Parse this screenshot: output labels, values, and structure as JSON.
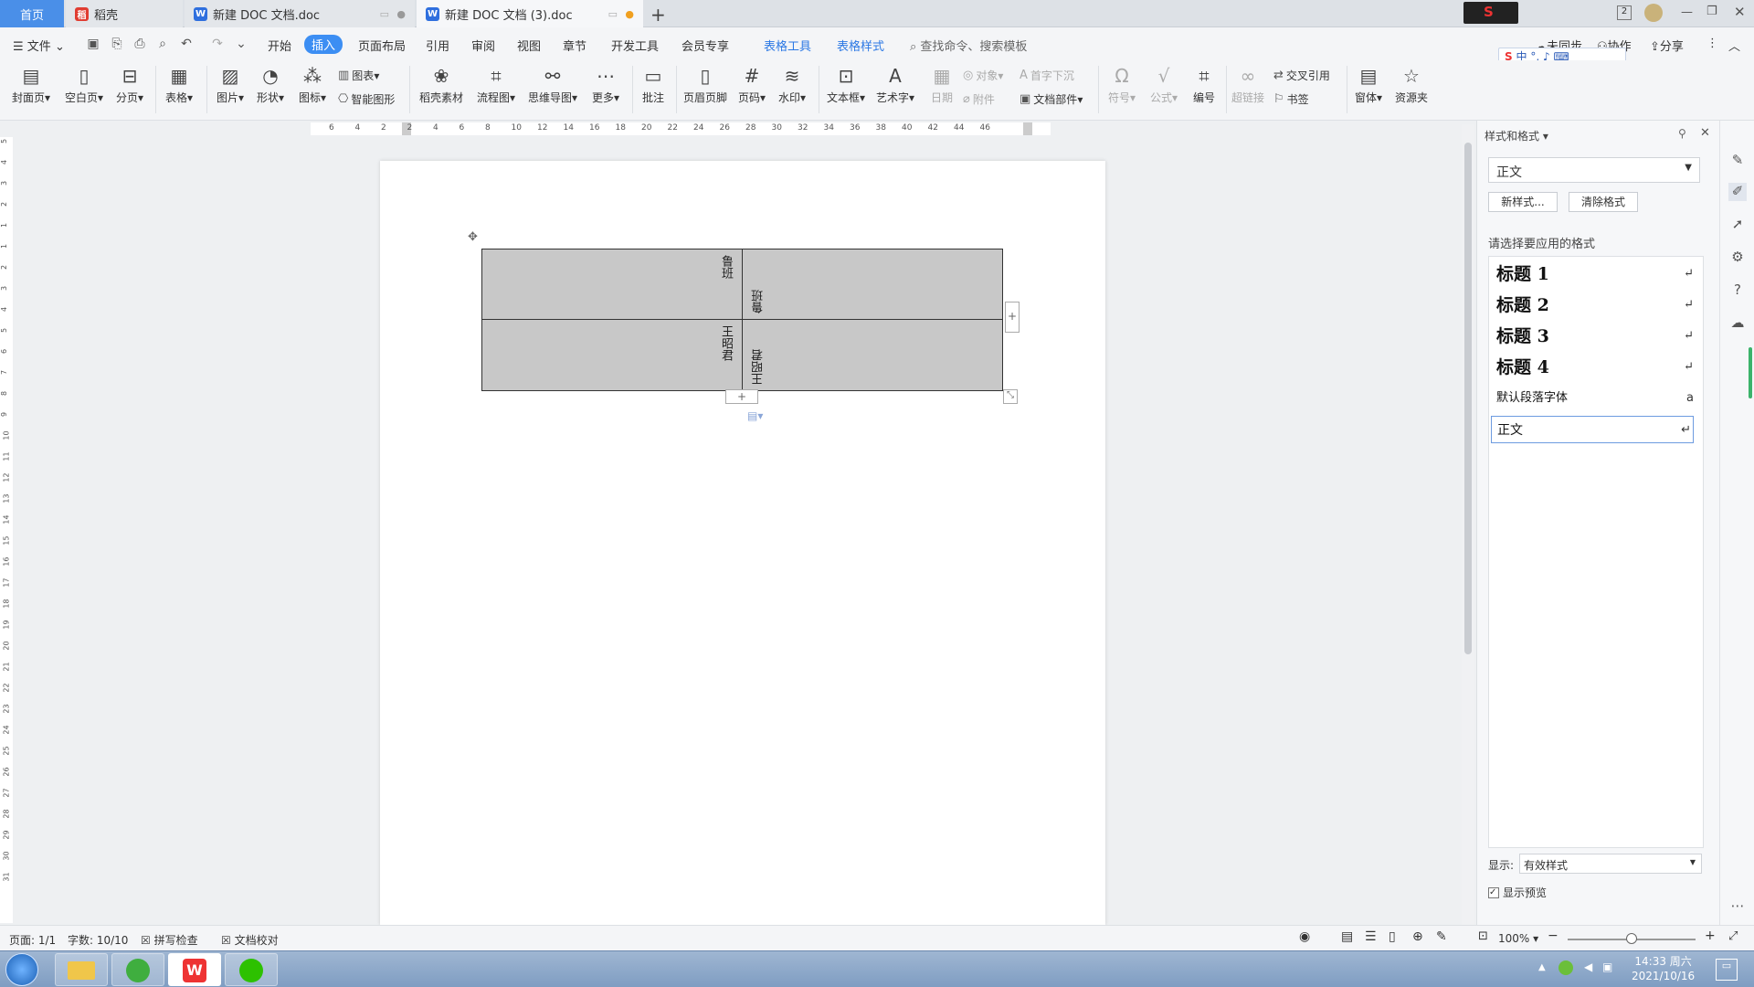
{
  "tabs": {
    "home": "首页",
    "daoke": "稻壳",
    "doc1": "新建 DOC 文档.doc",
    "doc2": "新建 DOC 文档 (3).doc"
  },
  "menubar": {
    "file": "文件",
    "items": [
      "开始",
      "插入",
      "页面布局",
      "引用",
      "审阅",
      "视图",
      "章节",
      "开发工具",
      "会员专享"
    ],
    "context_tabs": [
      "表格工具",
      "表格样式"
    ],
    "search": "查找命令、搜索模板",
    "sync": "未同步",
    "collab": "协作",
    "share": "分享"
  },
  "ribbon": {
    "cover": "封面页",
    "blank": "空白页",
    "pagebreak": "分页",
    "table": "表格",
    "picture": "图片",
    "shape": "形状",
    "icon": "图标",
    "chart": "图表",
    "smartart": "智能图形",
    "daoke_material": "稻壳素材",
    "flowchart": "流程图",
    "mindmap": "思维导图",
    "more": "更多",
    "comment": "批注",
    "header_footer": "页眉页脚",
    "page_number": "页码",
    "watermark": "水印",
    "textbox": "文本框",
    "wordart": "艺术字",
    "date": "日期",
    "object": "对象",
    "attachment": "附件",
    "dropcap": "首字下沉",
    "doc_parts": "文档部件",
    "symbol": "符号",
    "formula": "公式",
    "numbering": "编号",
    "hyperlink": "超链接",
    "crossref": "交叉引用",
    "bookmark": "书签",
    "window": "窗体",
    "resource": "资源夹"
  },
  "ime": {
    "lang": "中"
  },
  "document": {
    "cell_a1": "鲁班",
    "cell_b1": "鲁班",
    "cell_a2": "王昭君",
    "cell_b2": "王昭君"
  },
  "panel": {
    "title": "样式和格式",
    "current_style": "正文",
    "new_style": "新样式...",
    "clear_format": "清除格式",
    "prompt": "请选择要应用的格式",
    "styles": [
      "标题 1",
      "标题 2",
      "标题 3",
      "标题 4",
      "默认段落字体",
      "正文"
    ],
    "show_label": "显示:",
    "show_value": "有效样式",
    "preview": "显示预览"
  },
  "statusbar": {
    "page": "页面: 1/1",
    "words": "字数: 10/10",
    "spell": "拼写检查",
    "proof": "文档校对",
    "zoom": "100%"
  },
  "taskbar": {
    "time": "14:33 周六",
    "date": "2021/10/16"
  }
}
